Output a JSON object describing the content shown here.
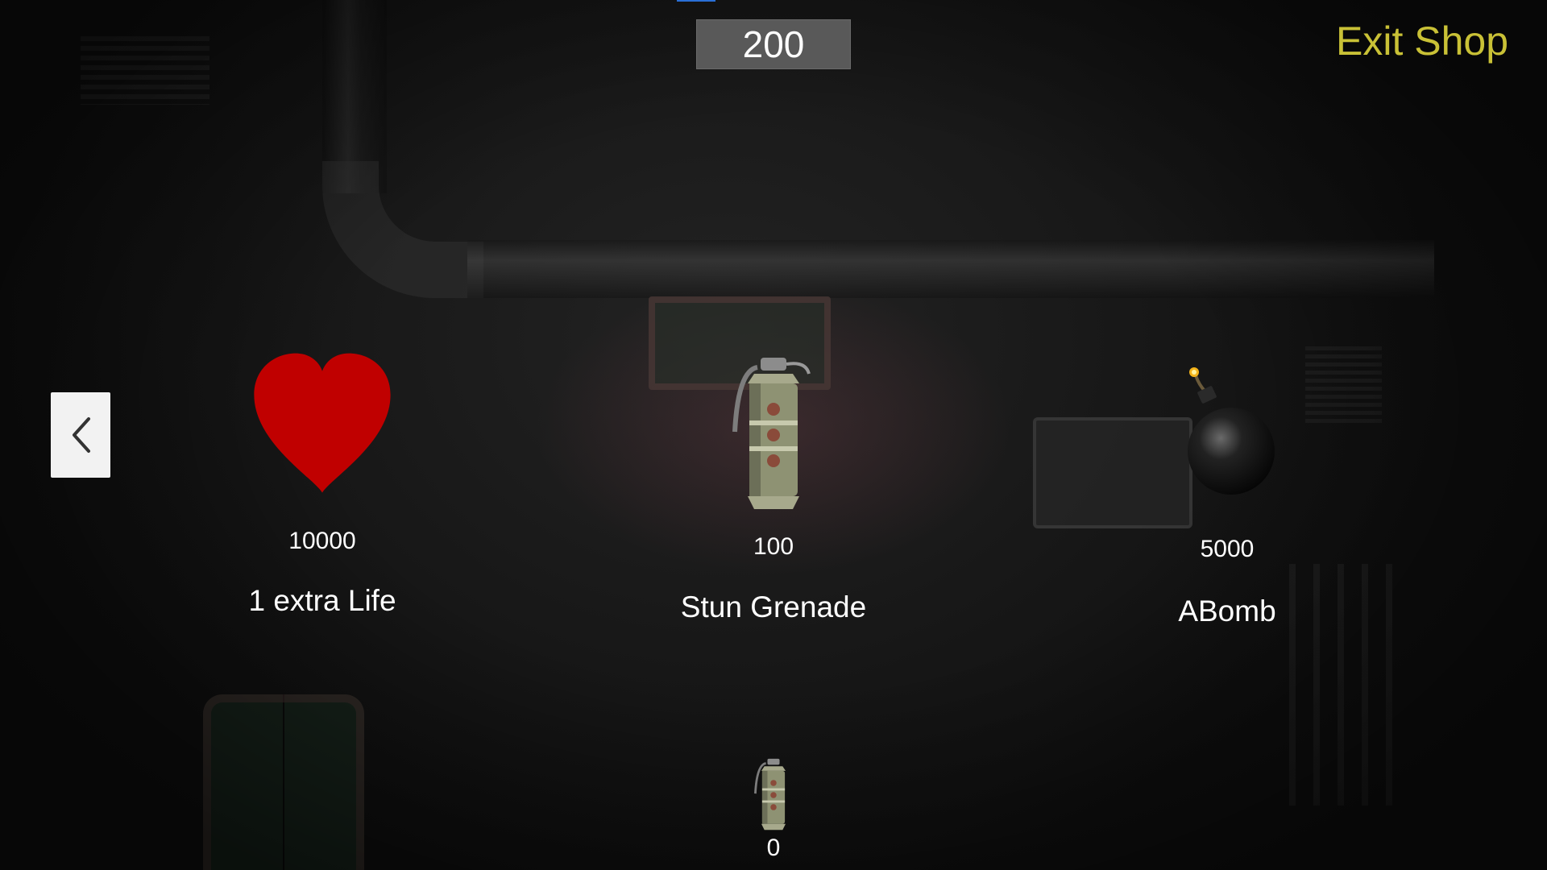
{
  "hud": {
    "currency": "200",
    "exit_label": "Exit Shop"
  },
  "navigation": {
    "prev_icon": "chevron-left-icon"
  },
  "shop_items": [
    {
      "icon": "heart-icon",
      "price": "10000",
      "name": "1 extra Life",
      "color": "#c00000"
    },
    {
      "icon": "stun-grenade-icon",
      "price": "100",
      "name": "Stun Grenade",
      "color": "#8a8f6a"
    },
    {
      "icon": "bomb-icon",
      "price": "5000",
      "name": "ABomb",
      "color": "#1a1a1a"
    }
  ],
  "inventory": {
    "icon": "stun-grenade-icon",
    "count": "0"
  },
  "colors": {
    "exit_text": "#c9c136",
    "currency_box": "#595959",
    "text": "#ffffff"
  }
}
